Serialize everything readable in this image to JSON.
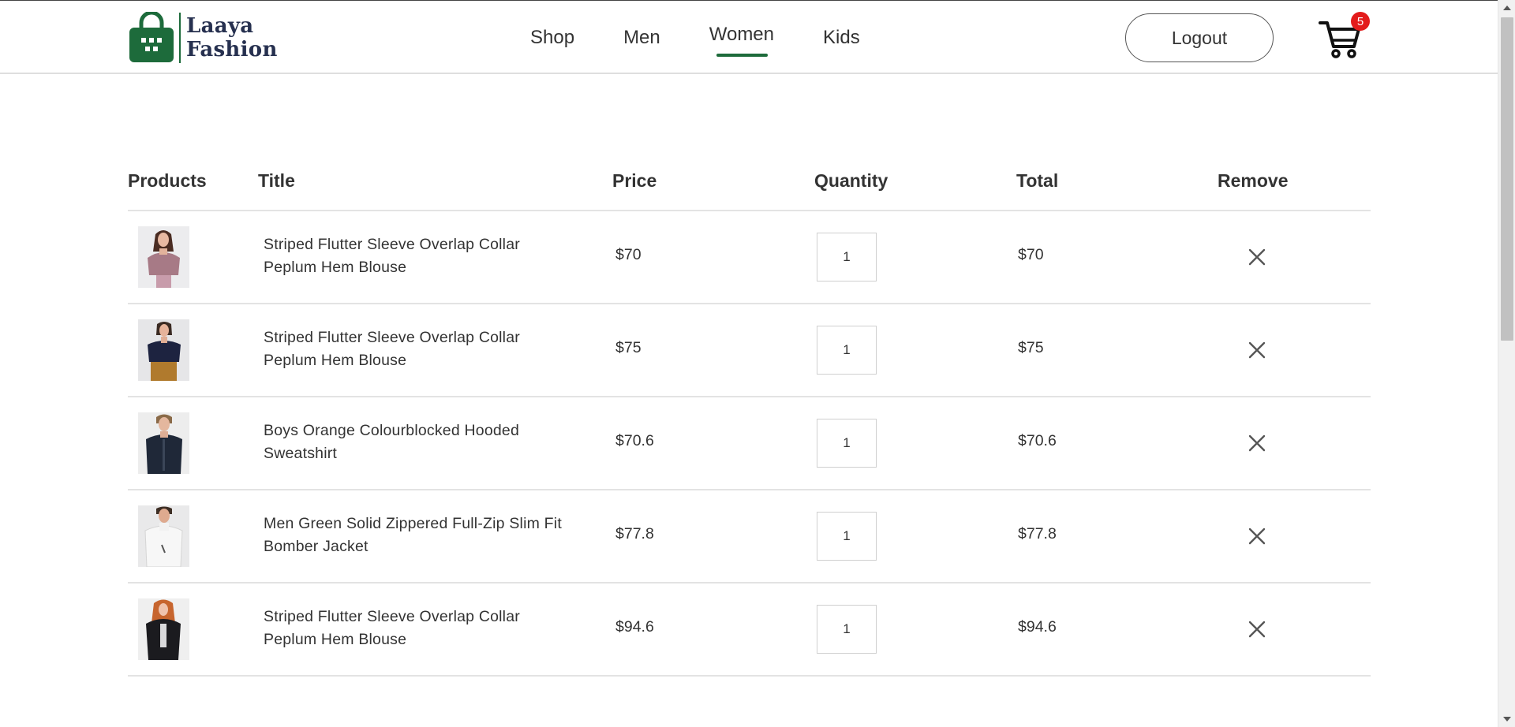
{
  "header": {
    "logo_line1": "Laaya",
    "logo_line2": "Fashion",
    "nav": [
      {
        "label": "Shop",
        "active": false
      },
      {
        "label": "Men",
        "active": false
      },
      {
        "label": "Women",
        "active": true
      },
      {
        "label": "Kids",
        "active": false
      }
    ],
    "logout_label": "Logout",
    "cart_count": "5",
    "brand_color": "#1d6b3b",
    "badge_color": "#e31b1b"
  },
  "table": {
    "headers": {
      "products": "Products",
      "title": "Title",
      "price": "Price",
      "quantity": "Quantity",
      "total": "Total",
      "remove": "Remove"
    },
    "rows": [
      {
        "title": "Striped Flutter Sleeve Overlap Collar Peplum Hem Blouse",
        "price": "$70",
        "quantity": "1",
        "total": "$70",
        "image": "woman-mauve-blouse"
      },
      {
        "title": "Striped Flutter Sleeve Overlap Collar Peplum Hem Blouse",
        "price": "$75",
        "quantity": "1",
        "total": "$75",
        "image": "woman-navy-top"
      },
      {
        "title": "Boys Orange Colourblocked Hooded Sweatshirt",
        "price": "$70.6",
        "quantity": "1",
        "total": "$70.6",
        "image": "boy-navy-jacket"
      },
      {
        "title": "Men Green Solid Zippered Full-Zip Slim Fit Bomber Jacket",
        "price": "$77.8",
        "quantity": "1",
        "total": "$77.8",
        "image": "man-white-jacket"
      },
      {
        "title": "Striped Flutter Sleeve Overlap Collar Peplum Hem Blouse",
        "price": "$94.6",
        "quantity": "1",
        "total": "$94.6",
        "image": "woman-black-fur-jacket"
      }
    ]
  }
}
